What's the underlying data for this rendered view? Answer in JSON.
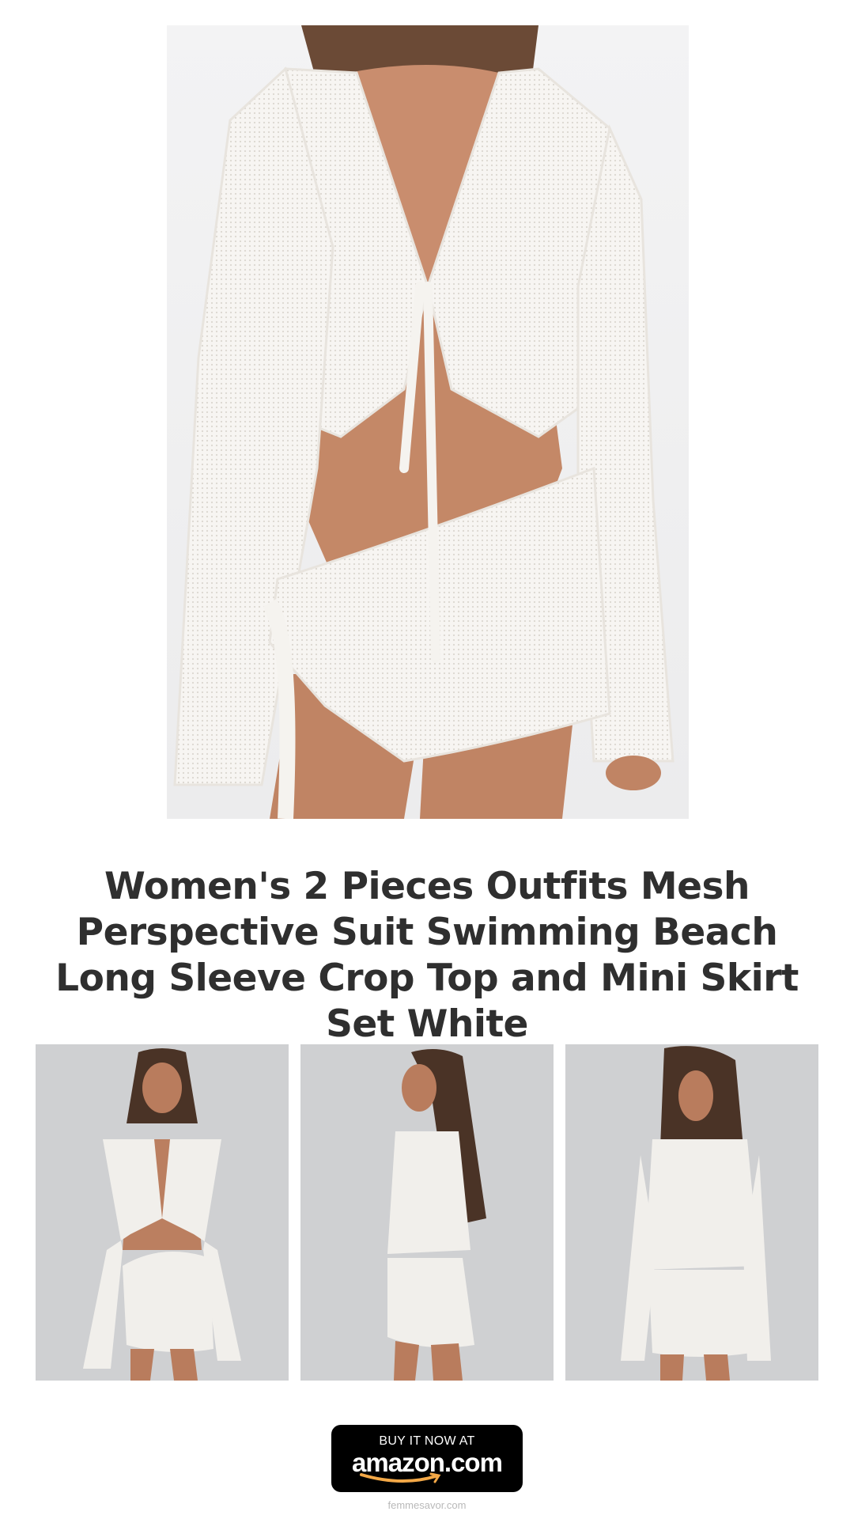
{
  "hero": {
    "image_alt": "Model wearing white mesh tie-front crop top and wrap mini skirt set"
  },
  "product": {
    "title": "Women's 2 Pieces Outfits Mesh Perspective Suit Swimming Beach Long Sleeve Crop Top and Mini Skirt Set White"
  },
  "thumbnails": [
    {
      "alt": "Front view"
    },
    {
      "alt": "Side view"
    },
    {
      "alt": "Back view"
    }
  ],
  "cta": {
    "top_text": "BUY IT NOW AT",
    "brand_text": "amazon.com",
    "smile_color": "#f3a847",
    "bg_color": "#000000"
  },
  "footer": {
    "site": "femmesavor.com"
  }
}
